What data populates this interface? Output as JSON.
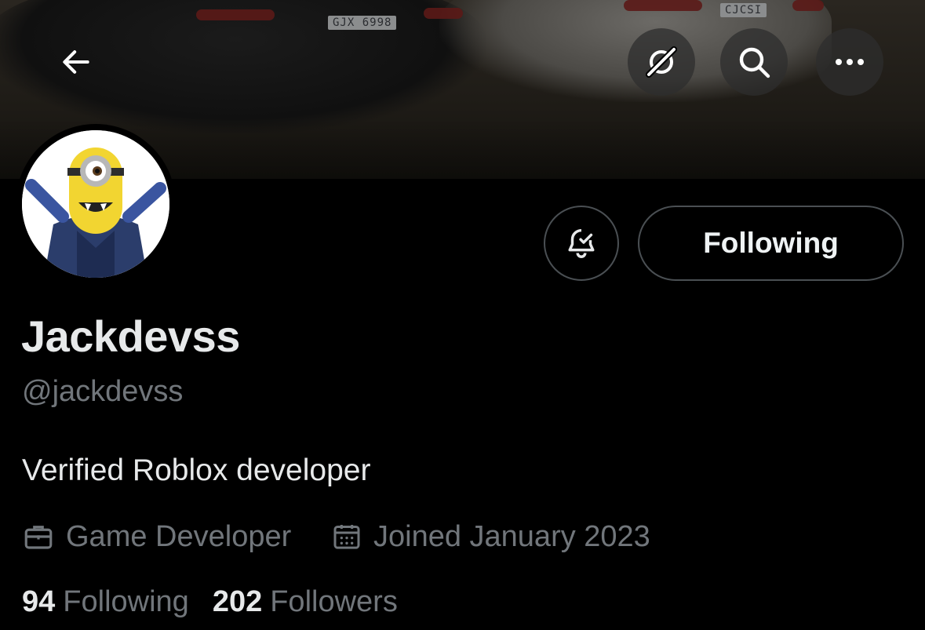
{
  "banner": {
    "plate_left": "GJX 6998",
    "plate_right": "CJCSI"
  },
  "header": {
    "back_icon": "arrow-left-icon",
    "grok_icon": "grok-icon",
    "search_icon": "search-icon",
    "more_icon": "more-horizontal-icon"
  },
  "profile": {
    "display_name": "Jackdevss",
    "handle": "@jackdevss",
    "bio": "Verified Roblox developer",
    "profession": "Game Developer",
    "joined": "Joined January 2023"
  },
  "actions": {
    "notify_icon": "bell-check-icon",
    "follow_label": "Following"
  },
  "stats": {
    "following_count": "94",
    "following_label": "Following",
    "followers_count": "202",
    "followers_label": "Followers"
  },
  "colors": {
    "background": "#000000",
    "primary_text": "#e7e9ea",
    "secondary_text": "#71767b",
    "border": "#4a4f53"
  }
}
